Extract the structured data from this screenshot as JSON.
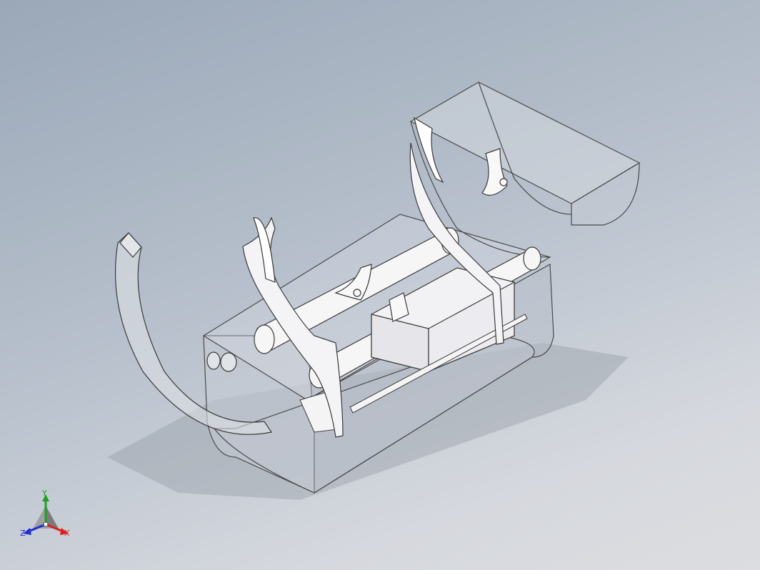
{
  "viewport": {
    "background_top": "#9aa8b8",
    "background_bottom": "#dcdde0",
    "model_line_color": "#3a3a3a",
    "transparent_body_fill": "#c9ced6"
  },
  "triad": {
    "x_label": "X",
    "y_label": "Y",
    "z_label": "Z",
    "x_color": "#e02020",
    "y_color": "#20a020",
    "z_color": "#2030d0"
  }
}
